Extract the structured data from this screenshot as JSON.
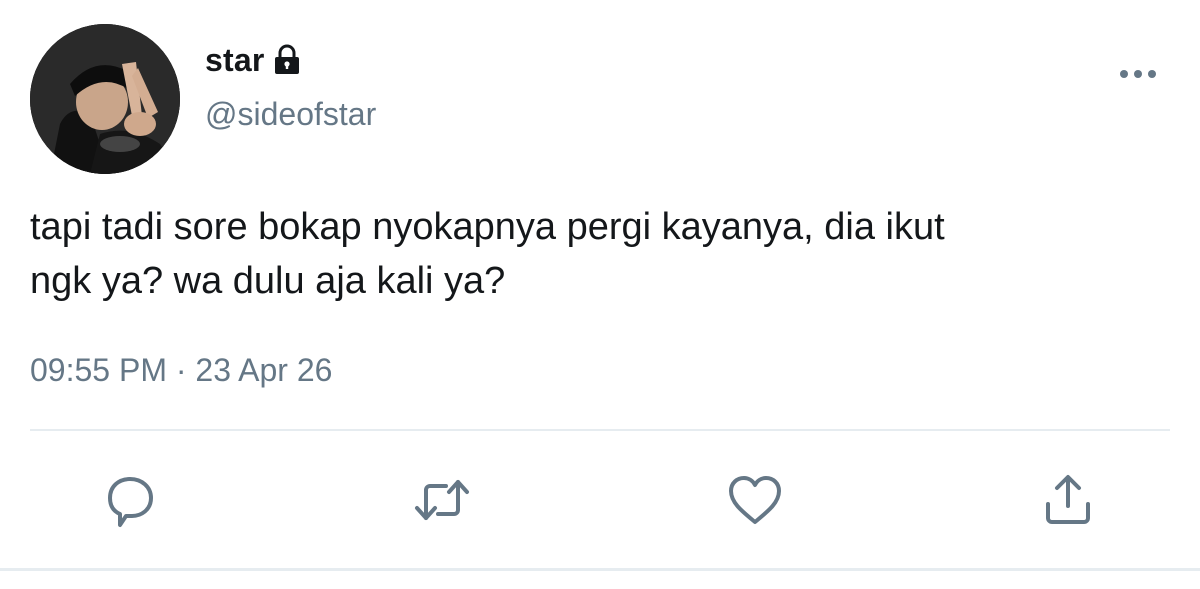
{
  "user": {
    "display_name": "star",
    "handle": "@sideofstar",
    "protected_icon": "lock-icon",
    "avatar_icon": "user-avatar"
  },
  "tweet": {
    "text": "tapi tadi sore bokap nyokapnya pergi kayanya, dia ikut\nngk ya? wa dulu aja kali ya?",
    "timestamp": "09:55 PM · 23 Apr 26"
  },
  "actions": {
    "more_icon": "more-horizontal-icon",
    "reply_icon": "reply-icon",
    "retweet_icon": "retweet-icon",
    "like_icon": "heart-icon",
    "share_icon": "share-icon"
  },
  "colors": {
    "text_primary": "#14171a",
    "text_secondary": "#657786",
    "icon": "#657786",
    "divider": "#e6ecf0"
  }
}
